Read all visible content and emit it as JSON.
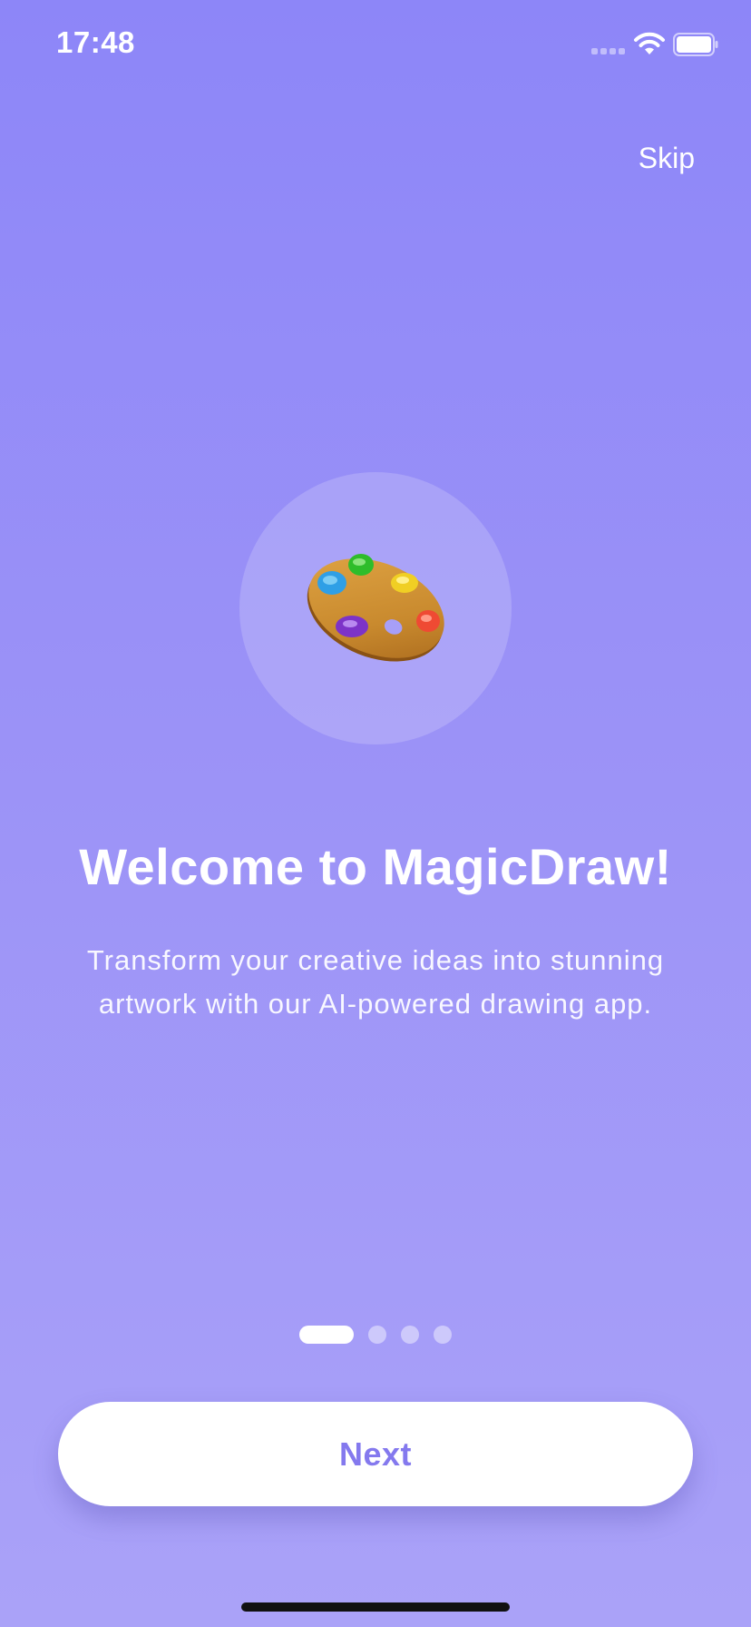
{
  "status_bar": {
    "time": "17:48"
  },
  "header": {
    "skip_label": "Skip"
  },
  "illustration": {
    "icon": "artist-palette-icon"
  },
  "content": {
    "title": "Welcome to MagicDraw!",
    "description_line1": "Transform your creative ideas into stunning",
    "description_line2": "artwork with our AI-powered drawing app."
  },
  "pager": {
    "current_page": 1,
    "total_pages": 4
  },
  "footer": {
    "next_label": "Next"
  },
  "colors": {
    "background_top": "#8d86f8",
    "background_bottom": "#aaa2f8",
    "accent": "#8479ee",
    "text_primary": "#ffffff"
  }
}
